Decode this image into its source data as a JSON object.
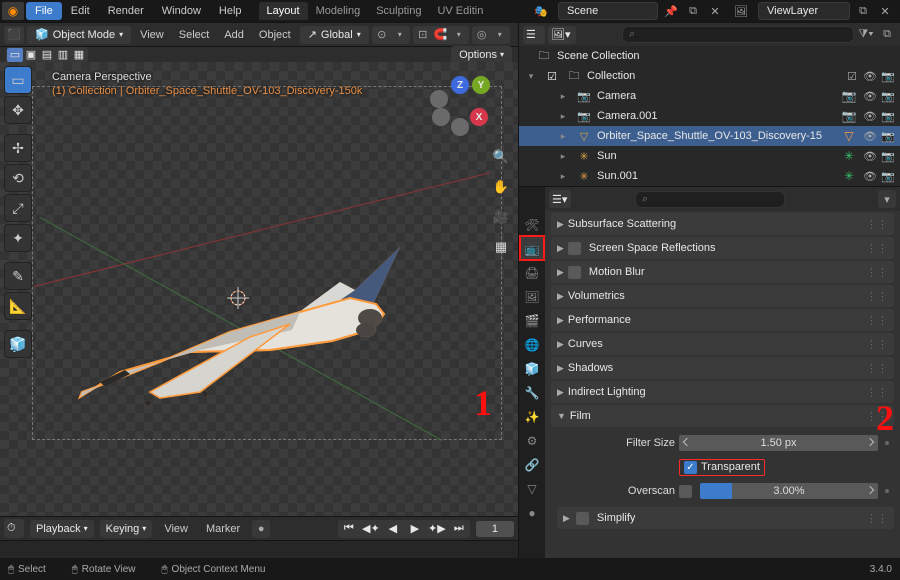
{
  "app": {
    "version": "3.4.0"
  },
  "menubar": {
    "file": "File",
    "edit": "Edit",
    "render": "Render",
    "window": "Window",
    "help": "Help"
  },
  "workspaces": {
    "layout": "Layout",
    "modeling": "Modeling",
    "sculpting": "Sculpting",
    "uv": "UV Editin"
  },
  "scene": {
    "scene_name": "Scene",
    "viewlayer_name": "ViewLayer"
  },
  "editor_header": {
    "mode": "Object Mode",
    "view": "View",
    "select": "Select",
    "add": "Add",
    "object": "Object",
    "orientation": "Global",
    "options": "Options"
  },
  "sel_row": {
    "options_dd": "Options"
  },
  "viewport_overlay": {
    "line1": "Camera Perspective",
    "line2": "(1) Collection | Orbiter_Space_Shuttle_OV-103_Discovery-150k"
  },
  "gizmo_axes": {
    "x": "X",
    "y": "Y",
    "z": "Z"
  },
  "timeline": {
    "playback": "Playback",
    "keying": "Keying",
    "view": "View",
    "marker": "Marker",
    "frame_current": "1"
  },
  "statusbar": {
    "select": "Select",
    "rotate": "Rotate View",
    "context": "Object Context Menu"
  },
  "outliner": {
    "scene_collection": "Scene Collection",
    "collection": "Collection",
    "items": [
      {
        "label": "Camera",
        "icon": "📷",
        "tint": "#3fbfa7"
      },
      {
        "label": "Camera.001",
        "icon": "📷",
        "tint": "#3fbfa7"
      },
      {
        "label": "Orbiter_Space_Shuttle_OV-103_Discovery-15",
        "icon": "▽",
        "tint": "#ff9a3c"
      },
      {
        "label": "Sun",
        "icon": "✳",
        "tint": "#37c06b"
      },
      {
        "label": "Sun.001",
        "icon": "✳",
        "tint": "#37c06b"
      }
    ]
  },
  "annotations": {
    "one": "1",
    "two": "2"
  },
  "properties": {
    "panels_collapsed": [
      "Subsurface Scattering",
      "Screen Space Reflections",
      "Motion Blur",
      "Volumetrics",
      "Performance",
      "Curves",
      "Shadows",
      "Indirect Lighting"
    ],
    "film": {
      "title": "Film",
      "filter_size_label": "Filter Size",
      "filter_size_value": "1.50 px",
      "transparent_label": "Transparent",
      "transparent_checked": true,
      "overscan_label": "Overscan",
      "overscan_checked": false,
      "overscan_value": "3.00%"
    },
    "simplify": "Simplify"
  }
}
